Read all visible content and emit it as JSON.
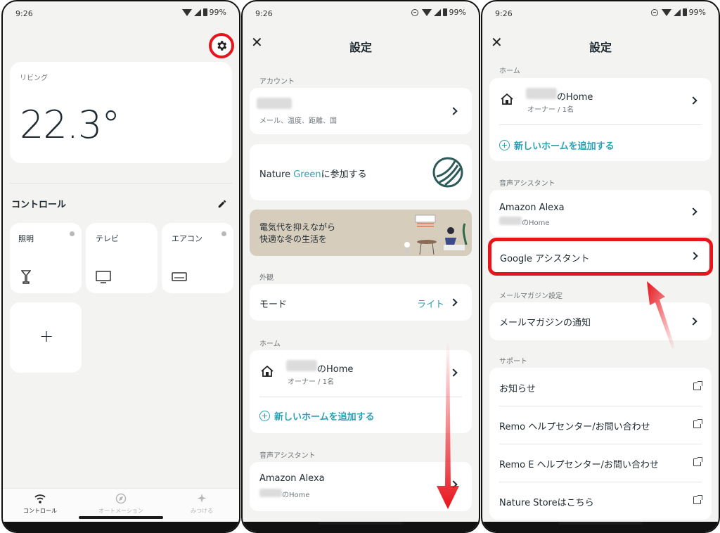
{
  "status": {
    "time": "9:26",
    "battery": "99%"
  },
  "p1": {
    "room_label": "リビング",
    "temperature": "22.3°",
    "section_title": "コントロール",
    "tiles": [
      {
        "label": "照明",
        "icon": "lamp-icon"
      },
      {
        "label": "テレビ",
        "icon": "tv-icon"
      },
      {
        "label": "エアコン",
        "icon": "aircon-icon"
      }
    ],
    "add_tile": "+",
    "tabs": [
      "コントロール",
      "オートメーション",
      "みつける"
    ]
  },
  "p2": {
    "title": "設定",
    "account_section": "アカウント",
    "account_sub": "メール、温度、距離、国",
    "nature_green_prefix": "Nature ",
    "nature_green_accent": "Green",
    "nature_green_suffix": "に参加する",
    "banner_line1": "電気代を抑えながら",
    "banner_line2": "快適な冬の生活を",
    "appearance_section": "外観",
    "mode_label": "モード",
    "mode_value": "ライト",
    "home_section": "ホーム",
    "home_name": "のHome",
    "home_sub": "オーナー / 1名",
    "add_home": "新しいホームを追加する",
    "voice_section": "音声アシスタント",
    "alexa": "Amazon Alexa",
    "alexa_sub": "のHome"
  },
  "p3": {
    "title": "設定",
    "home_section": "ホーム",
    "home_name": "のHome",
    "home_sub": "オーナー / 1名",
    "add_home": "新しいホームを追加する",
    "voice_section": "音声アシスタント",
    "alexa": "Amazon Alexa",
    "alexa_sub": "のHome",
    "google": "Google アシスタント",
    "mail_section": "メールマガジン設定",
    "mail_item": "メールマガジンの通知",
    "support_section": "サポート",
    "support_items": [
      "お知らせ",
      "Remo ヘルプセンター/お問い合わせ",
      "Remo E ヘルプセンター/お問い合わせ",
      "Nature Storeはこちら"
    ]
  },
  "colors": {
    "accent": "#2aa0b3",
    "highlight": "#e8141c"
  }
}
